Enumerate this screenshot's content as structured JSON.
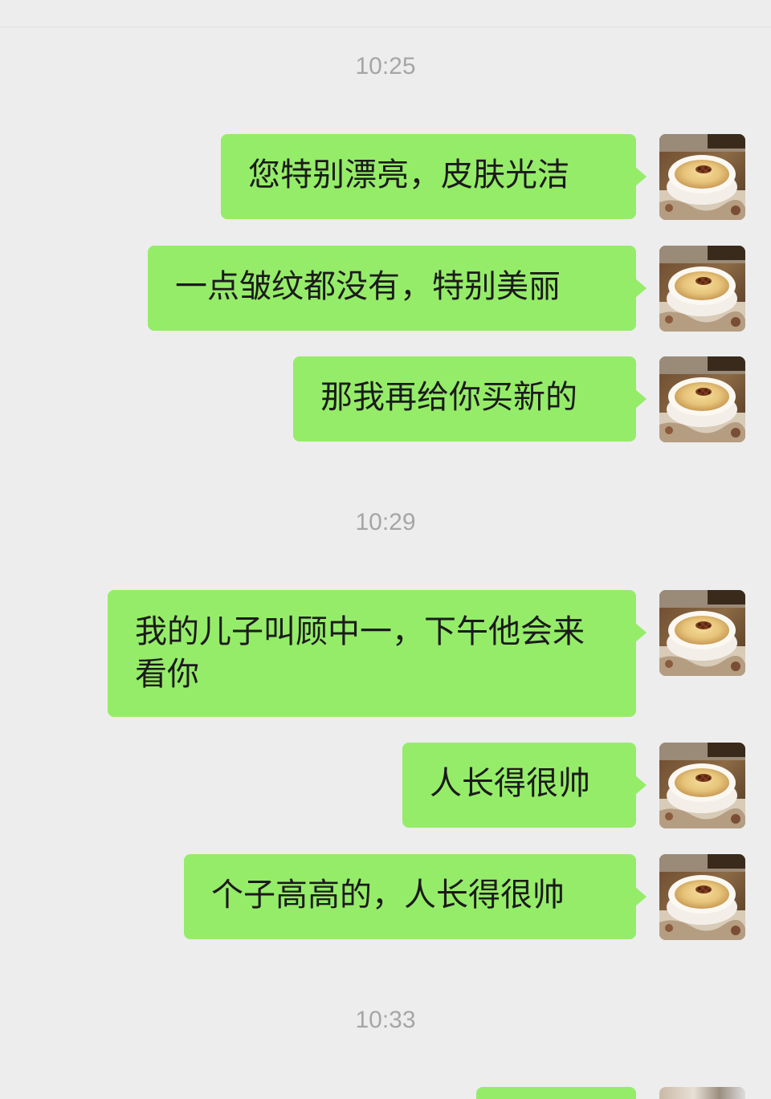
{
  "chat": {
    "timestamps": [
      "10:25",
      "10:29",
      "10:33"
    ],
    "messages": [
      {
        "text": "您特别漂亮，皮肤光洁"
      },
      {
        "text": "一点皱纹都没有，特别美丽"
      },
      {
        "text": "那我再给你买新的"
      },
      {
        "text": "我的儿子叫顾中一，下午他会来看你"
      },
      {
        "text": "人长得很帅"
      },
      {
        "text": "个子高高的，人长得很帅"
      }
    ]
  },
  "avatar": {
    "icon": "custard-dessert-avatar-icon"
  },
  "colors": {
    "background": "#ededed",
    "bubble": "#95ec69",
    "timestamp": "#a6a6a6",
    "text": "#1b1b1b"
  }
}
